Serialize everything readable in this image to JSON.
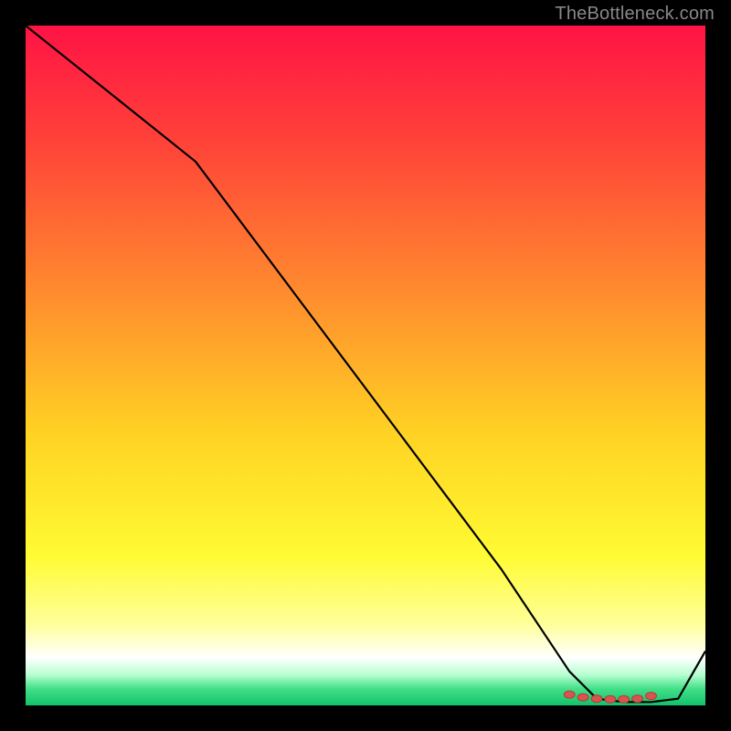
{
  "attribution": "TheBottleneck.com",
  "chart_data": {
    "type": "line",
    "title": "",
    "xlabel": "",
    "ylabel": "",
    "xlim": [
      0,
      100
    ],
    "ylim": [
      0,
      100
    ],
    "background_gradient": {
      "stops": [
        {
          "pos": 0.0,
          "color": "#ff1345"
        },
        {
          "pos": 0.18,
          "color": "#ff4538"
        },
        {
          "pos": 0.4,
          "color": "#ff8e2e"
        },
        {
          "pos": 0.6,
          "color": "#ffd223"
        },
        {
          "pos": 0.78,
          "color": "#fffb33"
        },
        {
          "pos": 0.88,
          "color": "#ffff9a"
        },
        {
          "pos": 0.93,
          "color": "#ffffff"
        },
        {
          "pos": 0.955,
          "color": "#b6ffd0"
        },
        {
          "pos": 0.975,
          "color": "#44e08a"
        },
        {
          "pos": 1.0,
          "color": "#11c26a"
        }
      ]
    },
    "series": [
      {
        "name": "curve",
        "x": [
          0,
          10,
          25,
          40,
          55,
          70,
          80,
          84,
          88,
          92,
          96,
          100
        ],
        "y": [
          100,
          92,
          80,
          60,
          40,
          20,
          5,
          1,
          0.5,
          0.5,
          1,
          8
        ]
      }
    ],
    "markers": {
      "name": "sweet-spot",
      "x": [
        80,
        82,
        84,
        86,
        88,
        90,
        92
      ],
      "y": [
        1.6,
        1.2,
        1.0,
        0.9,
        0.9,
        1.0,
        1.4
      ]
    }
  }
}
